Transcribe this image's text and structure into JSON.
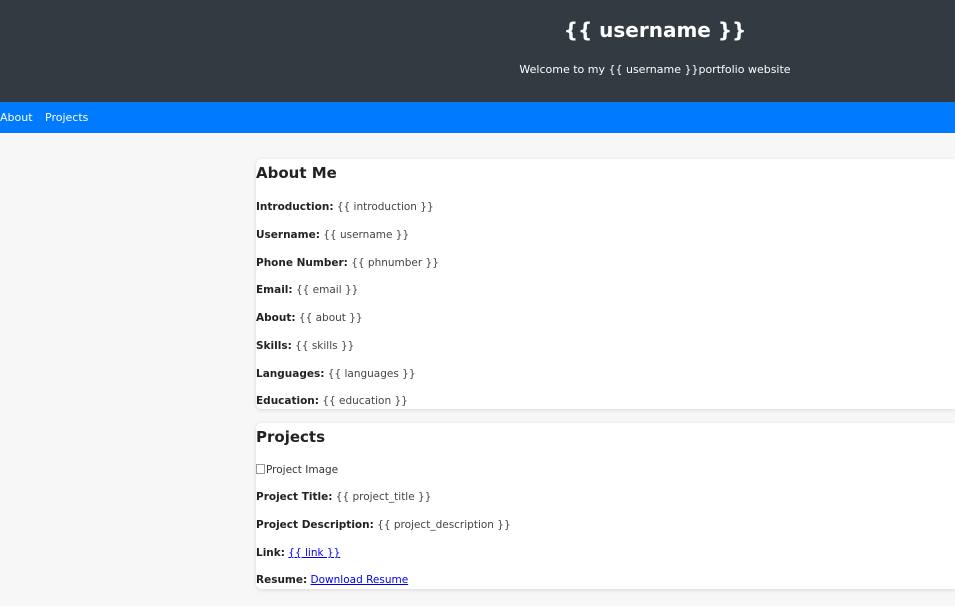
{
  "header": {
    "title": "{{ username }}",
    "subtitle": "Welcome to my {{ username }}portfolio website"
  },
  "nav": {
    "items": [
      {
        "label": "About"
      },
      {
        "label": "Projects"
      }
    ]
  },
  "about": {
    "heading": "About Me",
    "fields": [
      {
        "label": "Introduction:",
        "value": "{{ introduction }}"
      },
      {
        "label": "Username:",
        "value": "{{ username }}"
      },
      {
        "label": "Phone Number:",
        "value": "{{ phnumber }}"
      },
      {
        "label": "Email:",
        "value": "{{ email }}"
      },
      {
        "label": "About:",
        "value": "{{ about }}"
      },
      {
        "label": "Skills:",
        "value": "{{ skills }}"
      },
      {
        "label": "Languages:",
        "value": "{{ languages }}"
      },
      {
        "label": "Education:",
        "value": "{{ education }}"
      }
    ]
  },
  "projects": {
    "heading": "Projects",
    "image_alt": "Project Image",
    "title_label": "Project Title:",
    "title_value": "{{ project_title }}",
    "desc_label": "Project Description:",
    "desc_value": "{{ project_description }}",
    "link_label": "Link:",
    "link_value": "{{ link }}",
    "resume_label": "Resume:",
    "resume_link": "Download Resume"
  },
  "colors": {
    "header_bg": "#333a42",
    "nav_bg": "#007bff",
    "link": "#0000ee"
  }
}
